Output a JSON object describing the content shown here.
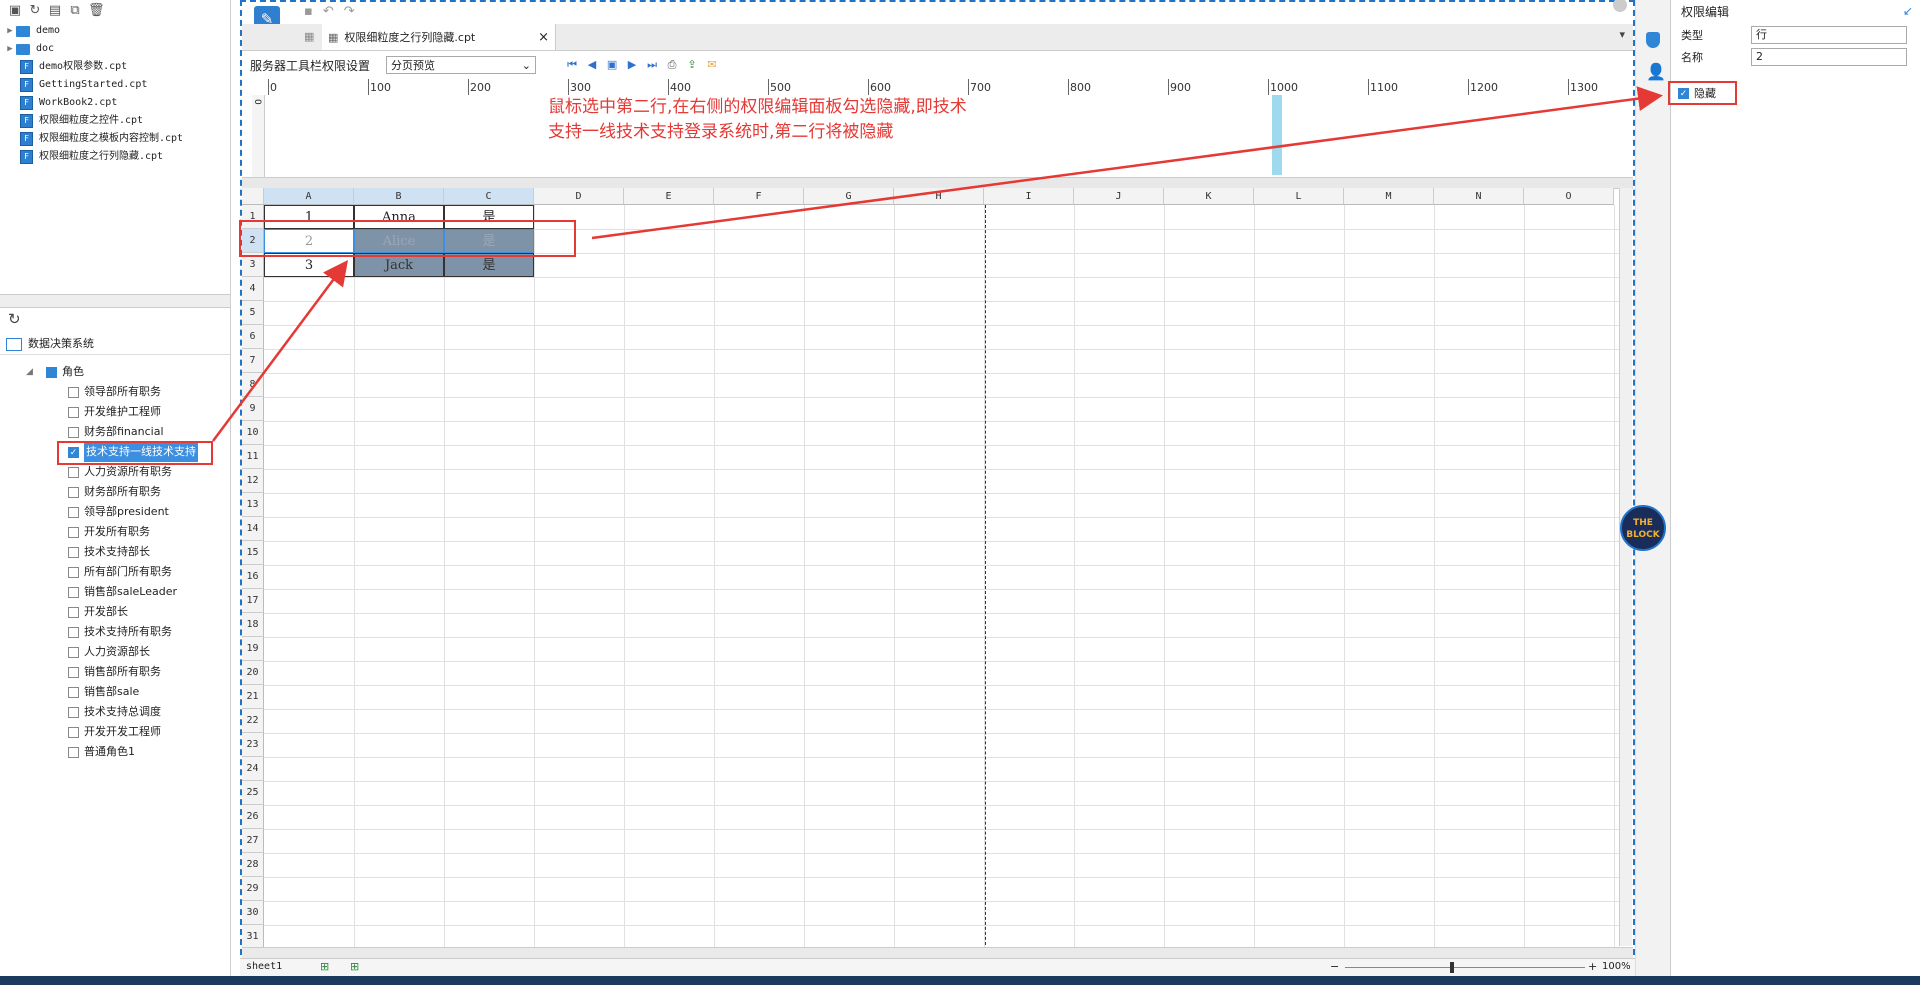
{
  "file_tree": {
    "items": [
      {
        "type": "folder",
        "label": "demo"
      },
      {
        "type": "folder",
        "label": "doc"
      },
      {
        "type": "file",
        "label": "demo权限参数.cpt"
      },
      {
        "type": "file",
        "label": "GettingStarted.cpt"
      },
      {
        "type": "file",
        "label": "WorkBook2.cpt"
      },
      {
        "type": "file",
        "label": "权限细粒度之控件.cpt"
      },
      {
        "type": "file",
        "label": "权限细粒度之模板内容控制.cpt"
      },
      {
        "type": "file",
        "label": "权限细粒度之行列隐藏.cpt"
      }
    ]
  },
  "roles_panel": {
    "system_label": "数据决策系统",
    "root_label": "角色",
    "roles": [
      {
        "label": "领导部所有职务",
        "checked": false
      },
      {
        "label": "开发维护工程师",
        "checked": false
      },
      {
        "label": "财务部financial",
        "checked": false
      },
      {
        "label": "技术支持一线技术支持",
        "checked": true
      },
      {
        "label": "人力资源所有职务",
        "checked": false
      },
      {
        "label": "财务部所有职务",
        "checked": false
      },
      {
        "label": "领导部president",
        "checked": false
      },
      {
        "label": "开发所有职务",
        "checked": false
      },
      {
        "label": "技术支持部长",
        "checked": false
      },
      {
        "label": "所有部门所有职务",
        "checked": false
      },
      {
        "label": "销售部saleLeader",
        "checked": false
      },
      {
        "label": "开发部长",
        "checked": false
      },
      {
        "label": "技术支持所有职务",
        "checked": false
      },
      {
        "label": "人力资源部长",
        "checked": false
      },
      {
        "label": "销售部所有职务",
        "checked": false
      },
      {
        "label": "销售部sale",
        "checked": false
      },
      {
        "label": "技术支持总调度",
        "checked": false
      },
      {
        "label": "开发开发工程师",
        "checked": false
      },
      {
        "label": "普通角色1",
        "checked": false
      }
    ]
  },
  "tab": {
    "label": "权限细粒度之行列隐藏.cpt"
  },
  "preview_toolbar": {
    "label": "服务器工具栏权限设置",
    "mode": "分页预览"
  },
  "ruler": {
    "ticks": [
      "0",
      "100",
      "200",
      "300",
      "400",
      "500",
      "600",
      "700",
      "800",
      "900",
      "1000",
      "1100",
      "1200",
      "1300"
    ]
  },
  "annotation": {
    "text": "鼠标选中第二行,在右侧的权限编辑面板勾选隐藏,即技术支持一线技术支持登录系统时,第二行将被隐藏"
  },
  "sheet": {
    "columns": [
      "A",
      "B",
      "C",
      "D",
      "E",
      "F",
      "G",
      "H",
      "I",
      "J",
      "K",
      "L",
      "M",
      "N",
      "O"
    ],
    "rows": [
      "1",
      "2",
      "3",
      "4",
      "5",
      "6",
      "7",
      "8",
      "9",
      "10",
      "11",
      "12",
      "13",
      "14",
      "15",
      "16",
      "17",
      "18",
      "19",
      "20",
      "21",
      "22",
      "23",
      "24",
      "25",
      "26",
      "27",
      "28",
      "29",
      "30",
      "31"
    ],
    "data": [
      [
        "1",
        "Anna",
        "是"
      ],
      [
        "2",
        "Alice",
        "是"
      ],
      [
        "3",
        "Jack",
        "是"
      ]
    ]
  },
  "status": {
    "sheet_tab": "sheet1",
    "zoom": "100%"
  },
  "permission_panel": {
    "title": "权限编辑",
    "type_label": "类型",
    "type_value": "行",
    "name_label": "名称",
    "name_value": "2",
    "hide_label": "隐藏",
    "hide_checked": true
  },
  "avatar": {
    "text": "THE BLOCK"
  },
  "colors": {
    "accent": "#1f73c9",
    "annotation": "#e53935",
    "selection": "#3b8ee0"
  }
}
